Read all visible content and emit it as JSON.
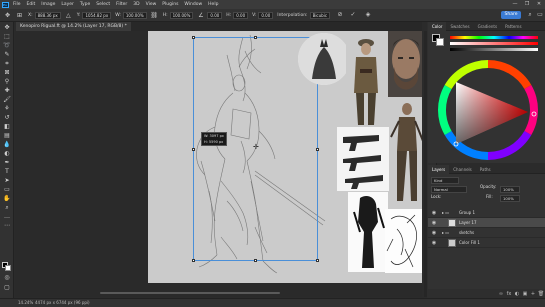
{
  "app": {
    "menu": [
      "File",
      "Edit",
      "Image",
      "Layer",
      "Type",
      "Select",
      "Filter",
      "3D",
      "View",
      "Plugins",
      "Window",
      "Help"
    ],
    "window_controls": [
      "—",
      "❐",
      "✕"
    ]
  },
  "options_bar": {
    "x_label": "X:",
    "x_value": "888.36 px",
    "y_label": "Y:",
    "y_value": "1054.82 px",
    "w_label": "W:",
    "w_value": "100.00%",
    "h_label": "H:",
    "h_value": "100.00%",
    "angle_value": "0.00",
    "h_skew": "0.00",
    "v_skew": "0.00",
    "interpolation_label": "Interpolation:",
    "interpolation_value": "Bicubic",
    "share_label": "Share"
  },
  "document": {
    "tab_title": "Kenopiro Rigual.ft @ 14.2% (Layer 17, RGB/8) *"
  },
  "canvas": {
    "measure_w": "W: 3097 px",
    "measure_h": "H: 5590 px"
  },
  "status": {
    "zoom": "14.24%",
    "info": "4474 px x 6744 px (96 ppi)"
  },
  "color_panel": {
    "tabs": [
      "Color",
      "Swatches",
      "Gradients",
      "Patterns"
    ],
    "active_tab": "Color"
  },
  "layers_panel": {
    "tabs": [
      "Layers",
      "Channels",
      "Paths"
    ],
    "active_tab": "Layers",
    "kind_label": "Kind",
    "blend_mode": "Normal",
    "opacity_label": "Opacity:",
    "opacity_value": "100%",
    "lock_label": "Lock:",
    "fill_label": "Fill:",
    "fill_value": "100%",
    "layers": [
      {
        "name": "Group 1",
        "selected": false
      },
      {
        "name": "Layer 17",
        "selected": true
      },
      {
        "name": "sketchs",
        "selected": false
      },
      {
        "name": "Color Fill 1",
        "selected": false
      }
    ],
    "bottom_icons": [
      "∞",
      "fx",
      "◐",
      "▣",
      "+",
      "🗑"
    ]
  },
  "colors": {
    "accent": "#31a8ff",
    "transform_outline": "#4a8fd8",
    "artboard": "#cbcbcb",
    "share_button": "#3a7bd5"
  }
}
